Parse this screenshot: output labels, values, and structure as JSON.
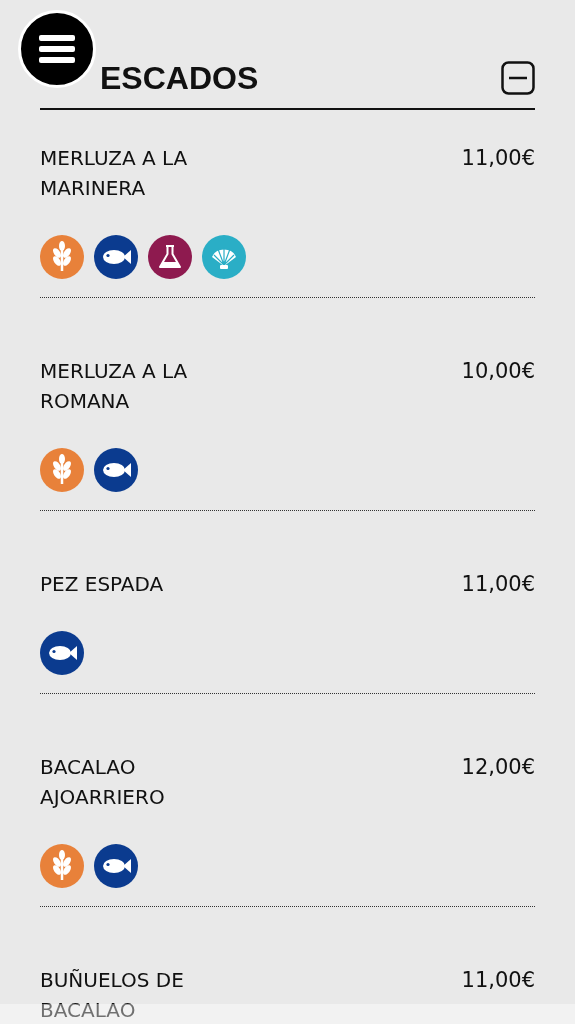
{
  "section": {
    "title": "ESCADOS",
    "expanded": true
  },
  "items": [
    {
      "name": "MERLUZA A LA MARINERA",
      "price": "11,00€",
      "allergens": [
        {
          "kind": "gluten",
          "color": "#e8813a"
        },
        {
          "kind": "fish",
          "color": "#0b3b8f"
        },
        {
          "kind": "sulphites",
          "color": "#8e1a4f"
        },
        {
          "kind": "molluscs",
          "color": "#2aaec6"
        }
      ]
    },
    {
      "name": "MERLUZA A LA ROMANA",
      "price": "10,00€",
      "allergens": [
        {
          "kind": "gluten",
          "color": "#e8813a"
        },
        {
          "kind": "fish",
          "color": "#0b3b8f"
        }
      ]
    },
    {
      "name": "PEZ ESPADA",
      "price": "11,00€",
      "allergens": [
        {
          "kind": "fish",
          "color": "#0b3b8f"
        }
      ]
    },
    {
      "name": "BACALAO AJOARRIERO",
      "price": "12,00€",
      "allergens": [
        {
          "kind": "gluten",
          "color": "#e8813a"
        },
        {
          "kind": "fish",
          "color": "#0b3b8f"
        }
      ]
    },
    {
      "name": "BUÑUELOS DE BACALAO",
      "price": "11,00€"
    }
  ]
}
